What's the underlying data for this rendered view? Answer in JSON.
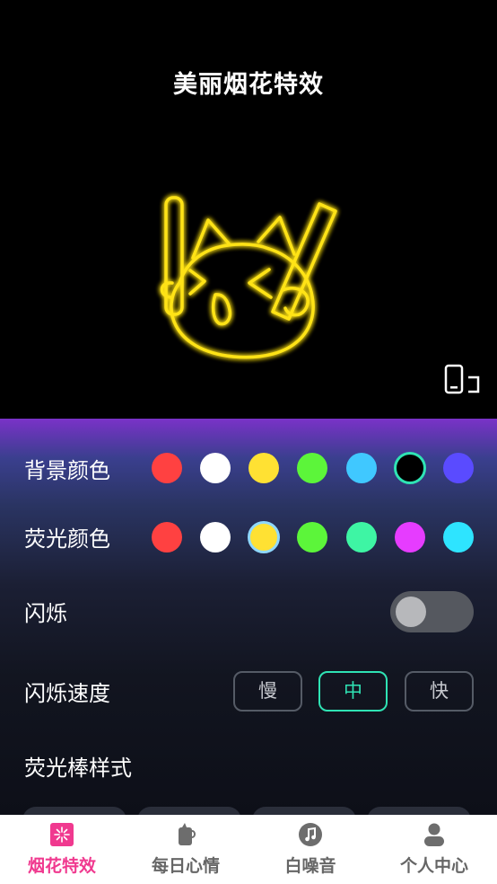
{
  "preview": {
    "title": "美丽烟花特效",
    "neon_color": "#ffe319",
    "rotate_icon": "rotate-screen-icon"
  },
  "settings": {
    "background_color": {
      "label": "背景颜色",
      "colors": [
        "#ff4141",
        "#ffffff",
        "#ffe133",
        "#5cf53a",
        "#40c8ff",
        "#000000",
        "#5a4bff"
      ],
      "selected": 5
    },
    "neon_color": {
      "label": "荧光颜色",
      "colors": [
        "#ff4141",
        "#ffffff",
        "#ffe133",
        "#5cf53a",
        "#3ef5a4",
        "#e63cff",
        "#2ee4ff"
      ],
      "selected": 2
    },
    "blink": {
      "label": "闪烁",
      "on": false
    },
    "blink_speed": {
      "label": "闪烁速度",
      "options": [
        "慢",
        "中",
        "快"
      ],
      "selected": 1
    },
    "stick_style": {
      "label": "荧光棒样式"
    }
  },
  "tabbar": {
    "tabs": [
      {
        "label": "烟花特效",
        "icon": "fireworks-icon",
        "active": true
      },
      {
        "label": "每日心情",
        "icon": "mood-cup-icon",
        "active": false
      },
      {
        "label": "白噪音",
        "icon": "music-note-icon",
        "active": false
      },
      {
        "label": "个人中心",
        "icon": "user-icon",
        "active": false
      }
    ],
    "active_color": "#f0398f"
  }
}
